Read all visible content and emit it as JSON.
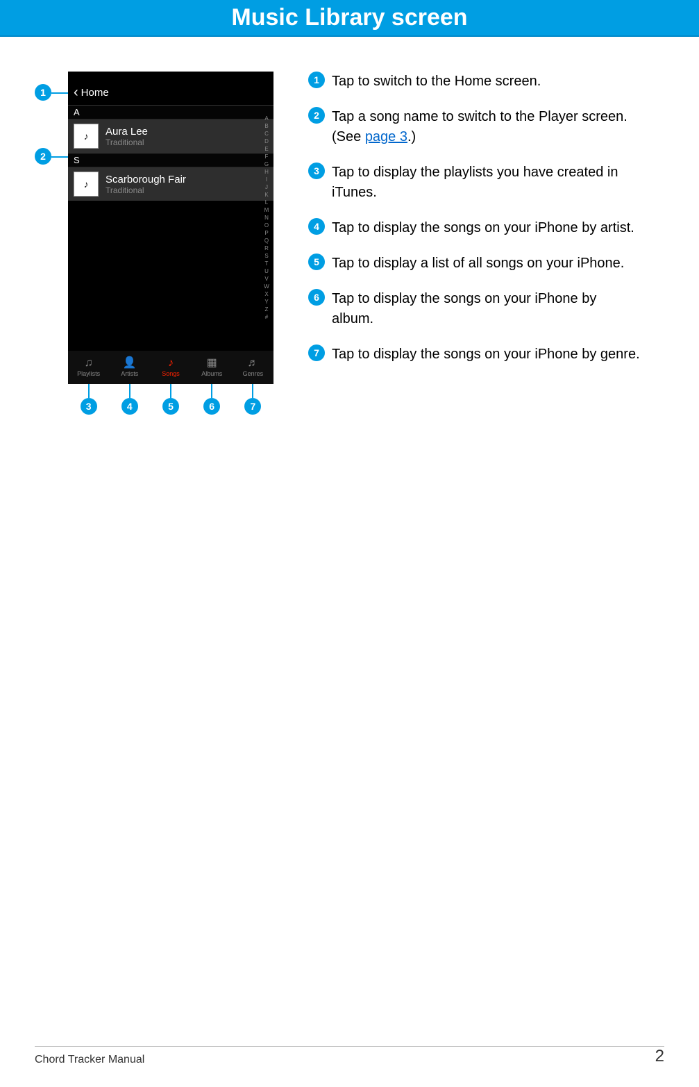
{
  "banner": {
    "title": "Music Library screen"
  },
  "phone": {
    "nav": {
      "back_label": "Home"
    },
    "sections": [
      {
        "letter": "A",
        "songs": [
          {
            "title": "Aura Lee",
            "artist": "Traditional"
          }
        ]
      },
      {
        "letter": "S",
        "songs": [
          {
            "title": "Scarborough Fair",
            "artist": "Traditional"
          }
        ]
      }
    ],
    "index": [
      "A",
      "B",
      "C",
      "D",
      "E",
      "F",
      "G",
      "H",
      "I",
      "J",
      "K",
      "L",
      "M",
      "N",
      "O",
      "P",
      "Q",
      "R",
      "S",
      "T",
      "U",
      "V",
      "W",
      "X",
      "Y",
      "Z",
      "#"
    ],
    "tabs": [
      {
        "label": "Playlists",
        "active": false
      },
      {
        "label": "Artists",
        "active": false
      },
      {
        "label": "Songs",
        "active": true
      },
      {
        "label": "Albums",
        "active": false
      },
      {
        "label": "Genres",
        "active": false
      }
    ]
  },
  "callouts": [
    "1",
    "2",
    "3",
    "4",
    "5",
    "6",
    "7"
  ],
  "descriptions": [
    {
      "n": "1",
      "text": "Tap to switch to the Home screen."
    },
    {
      "n": "2",
      "text": "Tap a song name to switch to the Player screen. (See ",
      "link": "page 3",
      "after": ".)"
    },
    {
      "n": "3",
      "text": "Tap to display the playlists you have created in iTunes."
    },
    {
      "n": "4",
      "text": "Tap to display the songs on your iPhone by artist."
    },
    {
      "n": "5",
      "text": "Tap to display a list of all songs on your iPhone."
    },
    {
      "n": "6",
      "text": "Tap to display the songs on your iPhone by album."
    },
    {
      "n": "7",
      "text": "Tap to display the songs on your iPhone by genre."
    }
  ],
  "footer": {
    "manual": "Chord Tracker Manual",
    "page": "2"
  }
}
